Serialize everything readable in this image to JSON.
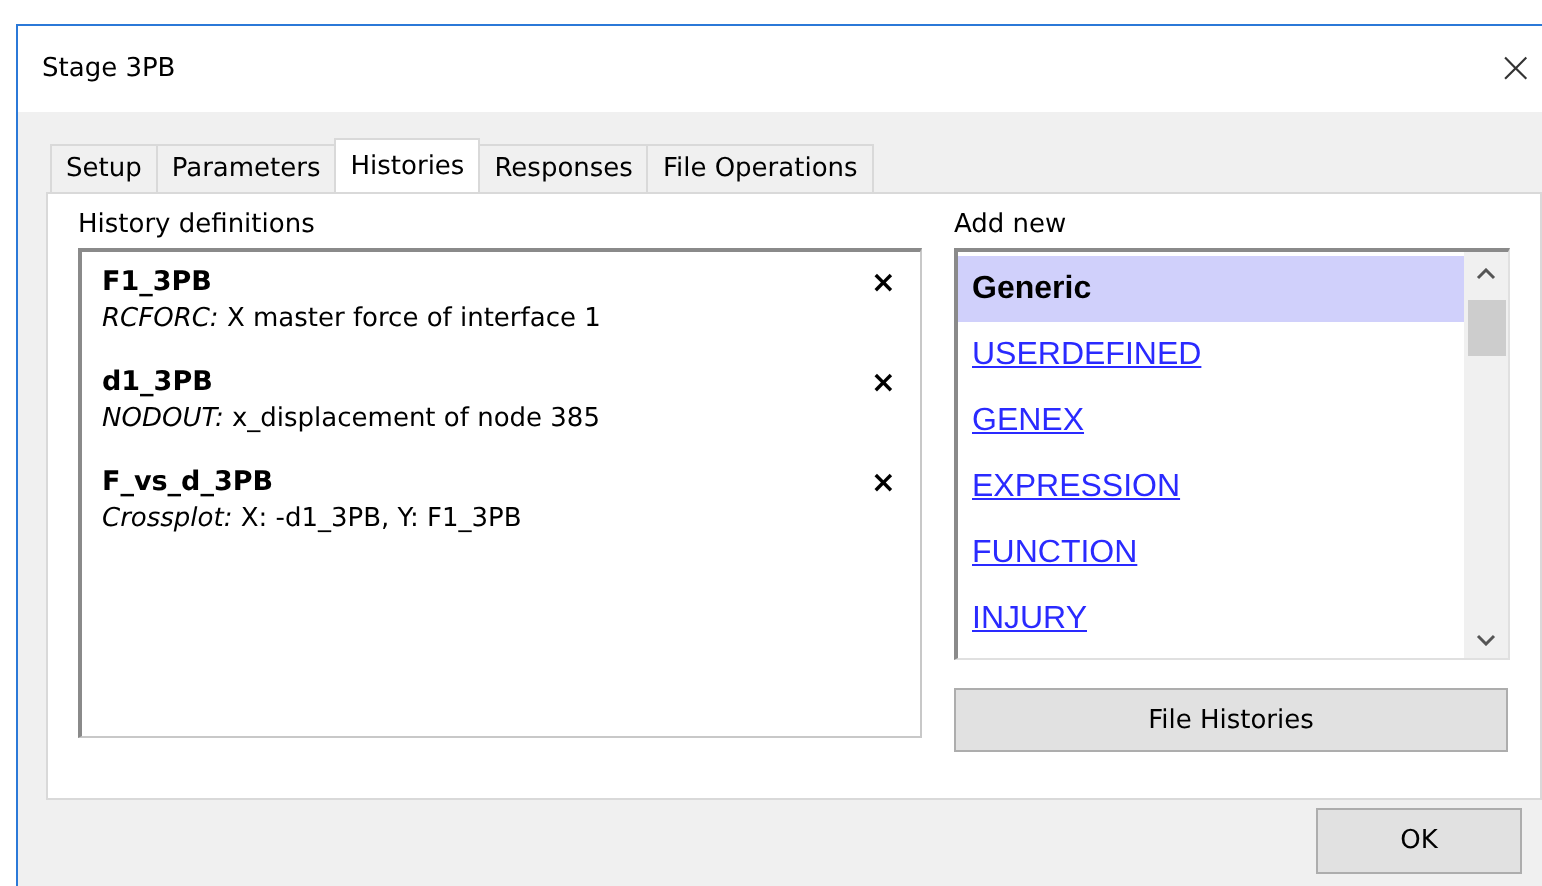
{
  "window": {
    "title": "Stage 3PB",
    "close": "×"
  },
  "tabs": [
    {
      "label": "Setup",
      "selected": false
    },
    {
      "label": "Parameters",
      "selected": false
    },
    {
      "label": "Histories",
      "selected": true
    },
    {
      "label": "Responses",
      "selected": false
    },
    {
      "label": "File Operations",
      "selected": false
    }
  ],
  "history_definitions": {
    "label": "History definitions",
    "items": [
      {
        "name": "F1_3PB",
        "source": "RCFORC:",
        "description": "X master force of interface 1",
        "remove": "×"
      },
      {
        "name": "d1_3PB",
        "source": "NODOUT:",
        "description": "x_displacement of node 385",
        "remove": "×"
      },
      {
        "name": "F_vs_d_3PB",
        "source": "Crossplot:",
        "description": "X: -d1_3PB, Y: F1_3PB",
        "remove": "×"
      }
    ]
  },
  "add_new": {
    "label": "Add new",
    "items": [
      {
        "kind": "header",
        "label": "Generic",
        "selected": true
      },
      {
        "kind": "link",
        "label": "USERDEFINED",
        "selected": false
      },
      {
        "kind": "link",
        "label": "GENEX",
        "selected": false
      },
      {
        "kind": "link",
        "label": "EXPRESSION",
        "selected": false
      },
      {
        "kind": "link",
        "label": "FUNCTION",
        "selected": false
      },
      {
        "kind": "link",
        "label": "INJURY",
        "selected": false
      }
    ],
    "button": "File Histories"
  },
  "buttons": [
    "OK"
  ]
}
